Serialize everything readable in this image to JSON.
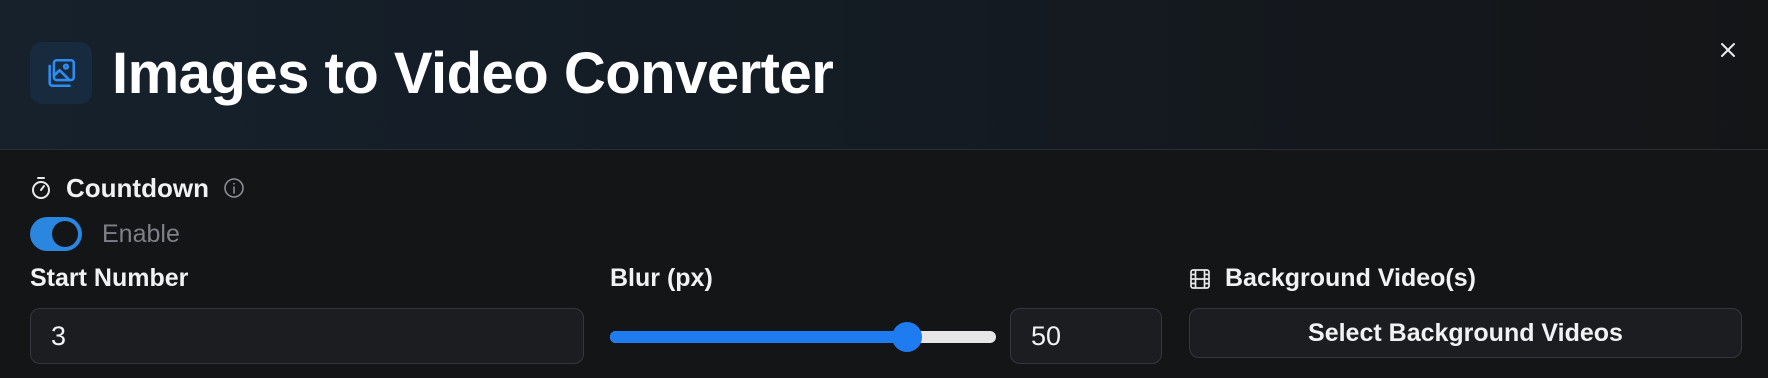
{
  "header": {
    "title": "Images to Video Converter",
    "app_icon": "images-stack-icon",
    "close_icon": "close-icon"
  },
  "countdown": {
    "section_title": "Countdown",
    "section_icon": "stopwatch-icon",
    "info_icon": "info-icon",
    "enable_label": "Enable",
    "enabled": true
  },
  "start_number": {
    "label": "Start Number",
    "value": "3"
  },
  "blur": {
    "label": "Blur (px)",
    "value": "50",
    "slider_fraction": 0.77
  },
  "background": {
    "label": "Background Video(s)",
    "icon": "film-icon",
    "button_label": "Select Background Videos"
  },
  "colors": {
    "accent": "#1f7cf0",
    "toggle_on": "#2b86e0",
    "background": "#141517"
  }
}
